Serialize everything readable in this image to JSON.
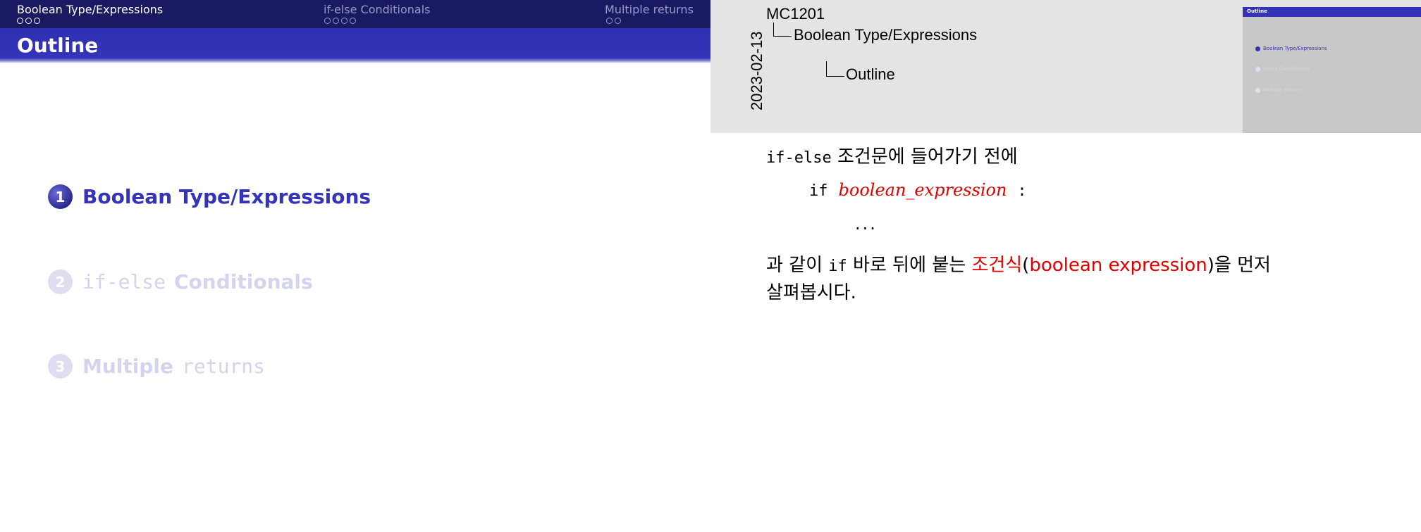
{
  "slide": {
    "nav": [
      {
        "label": "Boolean Type/Expressions",
        "dots": 3,
        "active": true
      },
      {
        "label": "if-else Conditionals",
        "dots": 4,
        "active": false
      },
      {
        "label": "Multiple returns",
        "dots": 2,
        "active": false
      }
    ],
    "frame_title": "Outline",
    "toc": [
      {
        "num": "1",
        "label": "Boolean Type/Expressions"
      },
      {
        "num": "2",
        "code": "if-else",
        "label": "Conditionals"
      },
      {
        "num": "3",
        "label": "Multiple",
        "code": "returns"
      }
    ]
  },
  "notes": {
    "date": "2023-02-13",
    "breadcrumb": {
      "course": "MC1201",
      "section": "Boolean Type/Expressions",
      "frame": "Outline"
    },
    "thumbnail": {
      "title": "Outline",
      "items": [
        "Boolean Type/Expressions",
        "if-else Conditionals",
        "Multiple returns"
      ]
    },
    "line1": {
      "code": "if-else",
      "text": " 조건문에 들어가기 전에"
    },
    "code": {
      "keyword": "if",
      "expr": "boolean_expression",
      "colon": ":"
    },
    "ellipsis": "...",
    "line2": {
      "pre": "과 같이 ",
      "code": "if",
      "mid": " 바로 뒤에 붙는 ",
      "term": "조건식",
      "paren_open": "(",
      "term_en": "boolean expression",
      "paren_close": ")",
      "post": "을 먼저"
    },
    "line3": "살펴봅시다."
  },
  "colors": {
    "navbar": "#1a1a63",
    "titlebar": "#3434b8",
    "accent": "#3434b8",
    "dim": "#d4d4ee",
    "highlight": "#e00000",
    "notes_bg": "#e4e4e4"
  }
}
